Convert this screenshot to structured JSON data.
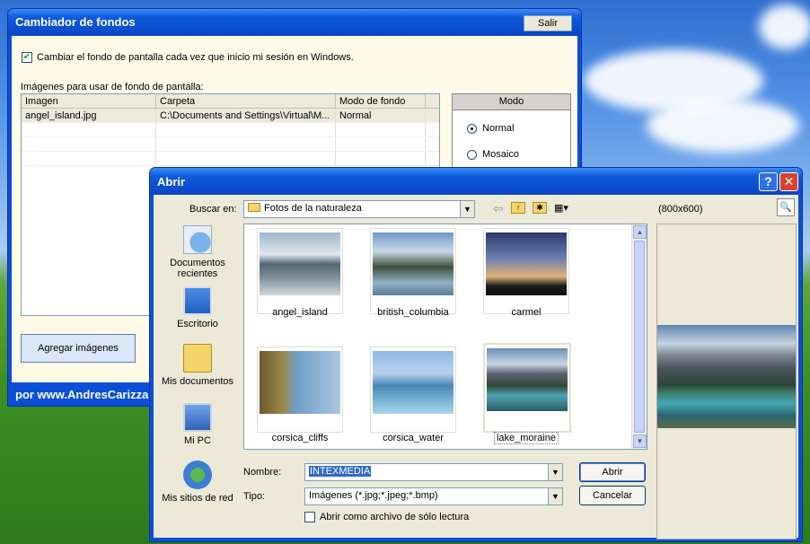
{
  "main_window": {
    "title": "Cambiador de fondos",
    "exit_label": "Salir",
    "auto_change_label": "Cambiar el fondo de pantalla cada vez que inicio mi sesión en Windows.",
    "list_label": "Imágenes para usar de fondo de pantalla:",
    "columns": [
      "Imagen",
      "Carpeta",
      "Modo de fondo"
    ],
    "rows": [
      {
        "image": "angel_island.jpg",
        "folder": "C:\\Documents and Settings\\Virtual\\M...",
        "mode": "Normal"
      }
    ],
    "mode_group": {
      "title": "Modo",
      "options": [
        "Normal",
        "Mosaico"
      ],
      "selected": "Normal"
    },
    "add_button": "Agregar imágenes",
    "footer": "por www.AndresCarizza"
  },
  "open_dialog": {
    "title": "Abrir",
    "look_in_label": "Buscar en:",
    "look_in_value": "Fotos de la naturaleza",
    "preview_size": "(800x600)",
    "places": [
      "Documentos recientes",
      "Escritorio",
      "Mis documentos",
      "Mi PC",
      "Mis sitios de red"
    ],
    "files": [
      "angel_island",
      "british_columbia",
      "carmel",
      "corsica_cliffs",
      "corsica_water",
      "lake_moraine"
    ],
    "selected_file": "lake_moraine",
    "filename_label": "Nombre:",
    "filename_value": "INTEXMEDIA",
    "type_label": "Tipo:",
    "type_value": "Imágenes (*.jpg;*.jpeg;*.bmp)",
    "readonly_label": "Abrir como archivo de sólo lectura",
    "open_button": "Abrir",
    "cancel_button": "Cancelar"
  },
  "colors": {
    "titlebar": "#0a4ed2",
    "dialog_bg": "#ece9d8",
    "main_bg": "#fffbe8",
    "close": "#d7432a"
  }
}
